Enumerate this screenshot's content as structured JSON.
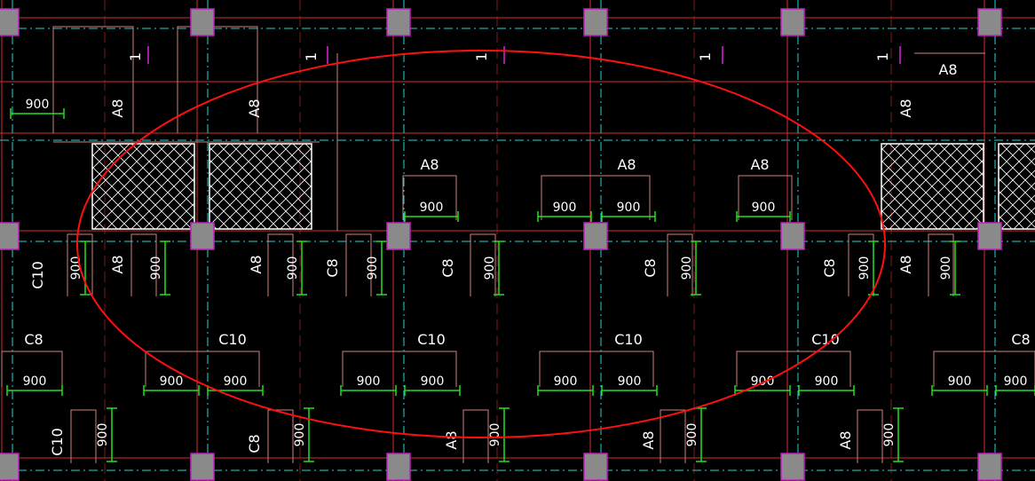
{
  "drawing": {
    "labels_top": [
      {
        "text": "1"
      },
      {
        "text": "1"
      },
      {
        "text": "1"
      },
      {
        "text": "1"
      },
      {
        "text": "1"
      }
    ],
    "labels_top_row": [
      {
        "text": "A8"
      },
      {
        "text": "A8"
      },
      {
        "text": "A8"
      },
      {
        "text": "A8"
      }
    ],
    "labels_mid_row": [
      {
        "text": "A8"
      },
      {
        "text": "A8"
      },
      {
        "text": "A8"
      }
    ],
    "labels_upper_vertical": [
      {
        "text": "C10"
      },
      {
        "text": "A8"
      },
      {
        "text": "A8"
      },
      {
        "text": "C8"
      },
      {
        "text": "C8"
      },
      {
        "text": "C8"
      },
      {
        "text": "C8"
      },
      {
        "text": "A8"
      }
    ],
    "labels_lower_row": [
      {
        "text": "C8"
      },
      {
        "text": "C10"
      },
      {
        "text": "C10"
      },
      {
        "text": "C10"
      },
      {
        "text": "C10"
      },
      {
        "text": "C8"
      }
    ],
    "labels_bottom_vertical": [
      {
        "text": "C10"
      },
      {
        "text": "C8"
      },
      {
        "text": "A8"
      },
      {
        "text": "A8"
      },
      {
        "text": "A8"
      }
    ],
    "dimension_value": "900",
    "colors": {
      "background": "#000000",
      "grid_red": "#d03030",
      "grid_cyan": "#20d8d8",
      "bar_pink": "#d08080",
      "column_fill": "#8a8a8a",
      "column_border": "#c020c0",
      "dimension_green": "#20e020",
      "annotation_ellipse": "#ff1010",
      "hatch": "#ffffff",
      "marker_magenta": "#e020e0"
    }
  }
}
